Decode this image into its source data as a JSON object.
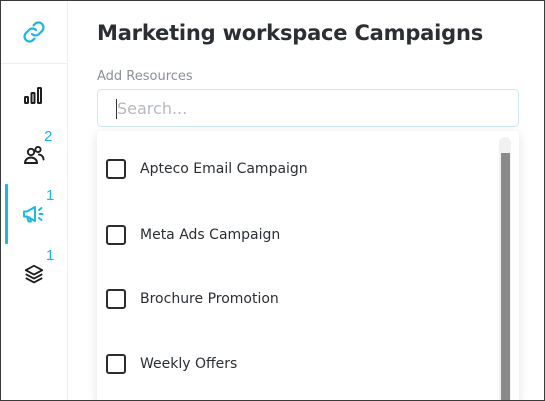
{
  "header": {
    "title": "Marketing workspace Campaigns",
    "resources_label": "Add Resources"
  },
  "search": {
    "placeholder": "Search...",
    "value": ""
  },
  "sidebar": {
    "items": [
      {
        "icon": "link-icon"
      },
      {
        "icon": "bar-chart-icon"
      },
      {
        "icon": "users-icon",
        "badge": "2"
      },
      {
        "icon": "megaphone-icon",
        "badge": "1",
        "active": true
      },
      {
        "icon": "layers-icon",
        "badge": "1"
      }
    ]
  },
  "options": [
    {
      "label": "Apteco Email Campaign",
      "checked": false
    },
    {
      "label": "Meta Ads Campaign",
      "checked": false
    },
    {
      "label": "Brochure Promotion",
      "checked": false
    },
    {
      "label": "Weekly Offers",
      "checked": false
    }
  ],
  "colors": {
    "accent": "#16b8e6",
    "title": "#2b2f33",
    "muted": "#8a9096"
  }
}
